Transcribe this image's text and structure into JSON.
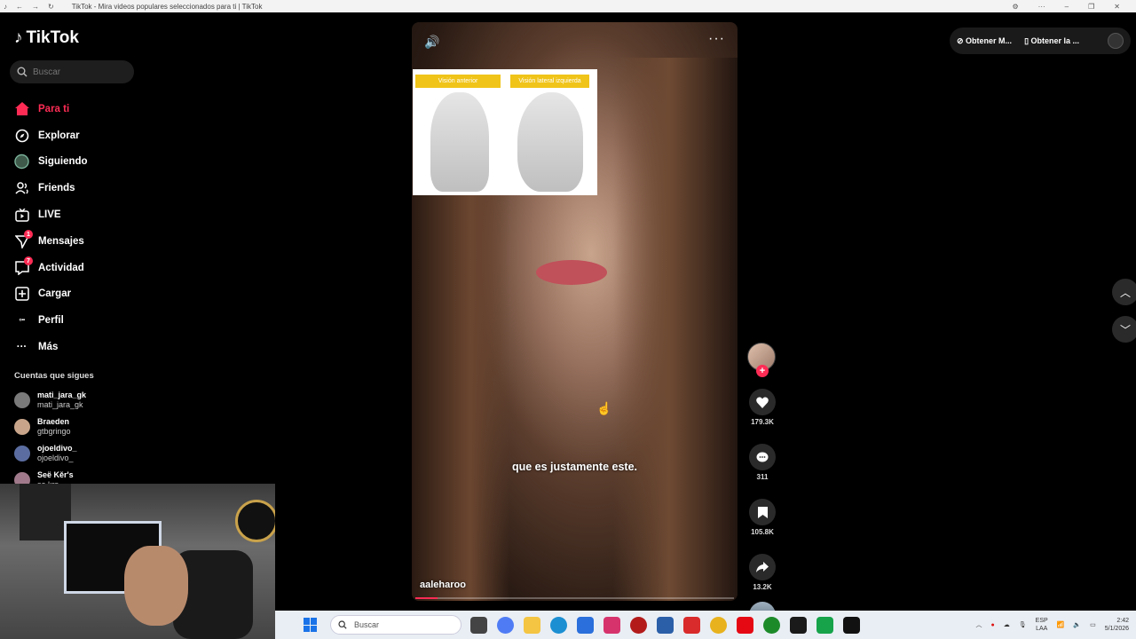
{
  "browser": {
    "title": "TikTok - Mira videos populares seleccionados para ti | TikTok"
  },
  "sidebar": {
    "logo": "TikTok",
    "search_placeholder": "Buscar",
    "items": [
      {
        "label": "Para ti",
        "icon": "home-icon",
        "active": true
      },
      {
        "label": "Explorar",
        "icon": "compass-icon"
      },
      {
        "label": "Siguiendo",
        "icon": "following-avatar-icon"
      },
      {
        "label": "Friends",
        "icon": "friends-icon"
      },
      {
        "label": "LIVE",
        "icon": "live-icon"
      },
      {
        "label": "Mensajes",
        "icon": "messages-icon",
        "badge": "1"
      },
      {
        "label": "Actividad",
        "icon": "activity-icon",
        "badge": "7"
      },
      {
        "label": "Cargar",
        "icon": "upload-icon"
      },
      {
        "label": "Perfil",
        "icon": "profile-icon"
      },
      {
        "label": "Más",
        "icon": "more-icon"
      }
    ],
    "following_title": "Cuentas que sigues",
    "following": [
      {
        "name": "mati_jara_gk",
        "handle": "mati_jara_gk"
      },
      {
        "name": "Braeden",
        "handle": "gtbgringo"
      },
      {
        "name": "ojoeldivo_",
        "handle": "ojoeldivo_"
      },
      {
        "name": "Seë Kěr's",
        "handle": "se.krs"
      }
    ]
  },
  "video": {
    "insert_labels": [
      "Visión anterior",
      "Visión lateral izquierda"
    ],
    "caption": "que es justamente este.",
    "username": "aaleharoo",
    "progress": 0.07
  },
  "actions": {
    "likes": "179.3K",
    "comments": "311",
    "saves": "105.8K",
    "shares": "13.2K"
  },
  "topbar": {
    "btn1": "Obtener M...",
    "btn2": "Obtener la ..."
  },
  "taskbar": {
    "search_placeholder": "Buscar",
    "lang1": "ESP",
    "lang2": "LAA",
    "time": "2:42",
    "date": "5/1/2026"
  },
  "colors": {
    "accent": "#fe2c55",
    "background": "#000000"
  }
}
